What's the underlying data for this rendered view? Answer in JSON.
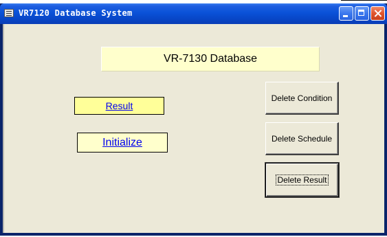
{
  "window": {
    "title": "VR7120 Database System",
    "title_icon": "app-form-icon",
    "controls": [
      "minimize-icon",
      "maximize-icon",
      "close-icon"
    ],
    "colors": {
      "titlebar": "#0a52d8",
      "client": "#ece9d8",
      "close": "#e0542c"
    }
  },
  "form": {
    "heading": "VR-7130 Database",
    "heading_bg": "#ffffcc",
    "links": {
      "result": "Result",
      "initialize": "Initialize"
    },
    "buttons": {
      "delete_condition": "Delete Condition",
      "delete_schedule": "Delete Schedule",
      "delete_result": "Delete Result"
    },
    "focused_button": "Delete Result"
  }
}
